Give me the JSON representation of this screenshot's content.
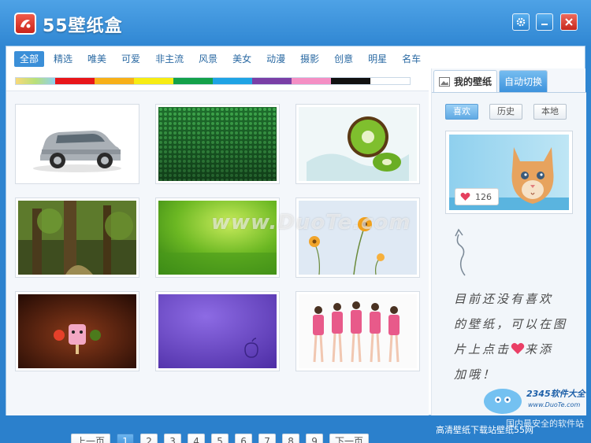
{
  "app": {
    "title": "55壁纸盒",
    "status_text": "高清壁纸下载站壁纸55网"
  },
  "categories": [
    {
      "label": "全部",
      "active": true
    },
    {
      "label": "精选"
    },
    {
      "label": "唯美"
    },
    {
      "label": "可爱"
    },
    {
      "label": "非主流"
    },
    {
      "label": "风景"
    },
    {
      "label": "美女"
    },
    {
      "label": "动漫"
    },
    {
      "label": "摄影"
    },
    {
      "label": "创意"
    },
    {
      "label": "明星"
    },
    {
      "label": "名车"
    }
  ],
  "color_filters": [
    "#f2e57c",
    "#e8161a",
    "#f7b019",
    "#f7ec13",
    "#13a14a",
    "#1fa3e4",
    "#7a3fa6",
    "#f48fc4",
    "#111111",
    "#ffffff"
  ],
  "wallpapers": [
    {
      "name": "suv-car"
    },
    {
      "name": "green-texture"
    },
    {
      "name": "kiwi-splash"
    },
    {
      "name": "forest"
    },
    {
      "name": "green-bokeh"
    },
    {
      "name": "flowers"
    },
    {
      "name": "ice-cream-cartoon"
    },
    {
      "name": "purple-apple"
    },
    {
      "name": "girl-group"
    }
  ],
  "pager": {
    "prev": "上一页",
    "next": "下一页",
    "pages": [
      "1",
      "2",
      "3",
      "4",
      "5",
      "6",
      "7",
      "8",
      "9"
    ],
    "current": "1"
  },
  "right_panel": {
    "tabs": {
      "mine": "我的壁纸",
      "auto": "自动切换"
    },
    "filters": {
      "like": "喜欢",
      "history": "历史",
      "local": "本地"
    },
    "like_count": "126",
    "hint_line1": "目前还没有喜欢",
    "hint_line2": "的壁纸，可以在图",
    "hint_line3_a": "片上点击",
    "hint_line3_b": "来添",
    "hint_line4": "加哦！"
  },
  "overlay": {
    "watermark": "www.DuoTe.com",
    "brand": "2345软件大全",
    "url": "www.DuoTe.com",
    "slogan": "国内最安全的软件站"
  }
}
